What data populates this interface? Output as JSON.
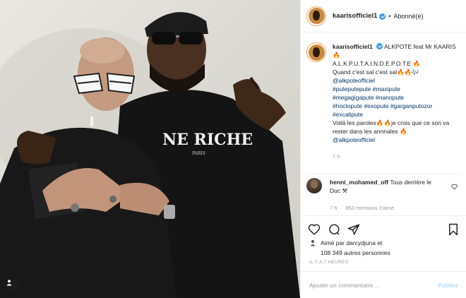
{
  "post": {
    "image_alt": "Two men posing in black outfits against a light wall"
  },
  "header": {
    "username": "kaarisofficiel1",
    "separator": "•",
    "follow_status": "Abonné(e)"
  },
  "caption": {
    "username": "kaarisofficiel1",
    "line1": "ALKPOTE feat Mr KAARIS 🔥",
    "line2": "A.L.K.P.U.T.A.I.N.D.E.P.O.T.E 🔥",
    "line3": "Quand c'est sal c'est sal🔥🔥🎶",
    "mention1": "@alkpoteofficiel",
    "hashtags": [
      "#puteputepute",
      "#maxipute",
      "#megagigapute",
      "#nanopute",
      "#hoctopute",
      "#exopute",
      "#garganputozor",
      "#excalipute"
    ],
    "line4": "Voilà les paroles🔥🔥je crois que ce son va rester dans les annnales 🔥",
    "mention2": "@alkpoteofficiel",
    "age": "7 h"
  },
  "comment": {
    "username": "henni_mohamed_off",
    "text": "Tous derrière le Duc ⚒",
    "age": "7 h",
    "likes": "853 mentions J'aime"
  },
  "likes": {
    "text_line1": "Aimé par darcydjuna et",
    "text_line2": "108 349 autres personnes"
  },
  "timestamp": "IL Y A 7 HEURES",
  "add_comment": {
    "placeholder": "Ajouter un commentaire...",
    "publish_label": "Publier"
  },
  "colors": {
    "link": "#003569",
    "verified": "#3897f0",
    "muted": "#999999",
    "publish_disabled": "#b3dbff"
  },
  "icons": [
    "user-tag-icon",
    "verified-icon",
    "heart-icon",
    "comment-icon",
    "share-icon",
    "bookmark-icon",
    "like-small-icon"
  ]
}
